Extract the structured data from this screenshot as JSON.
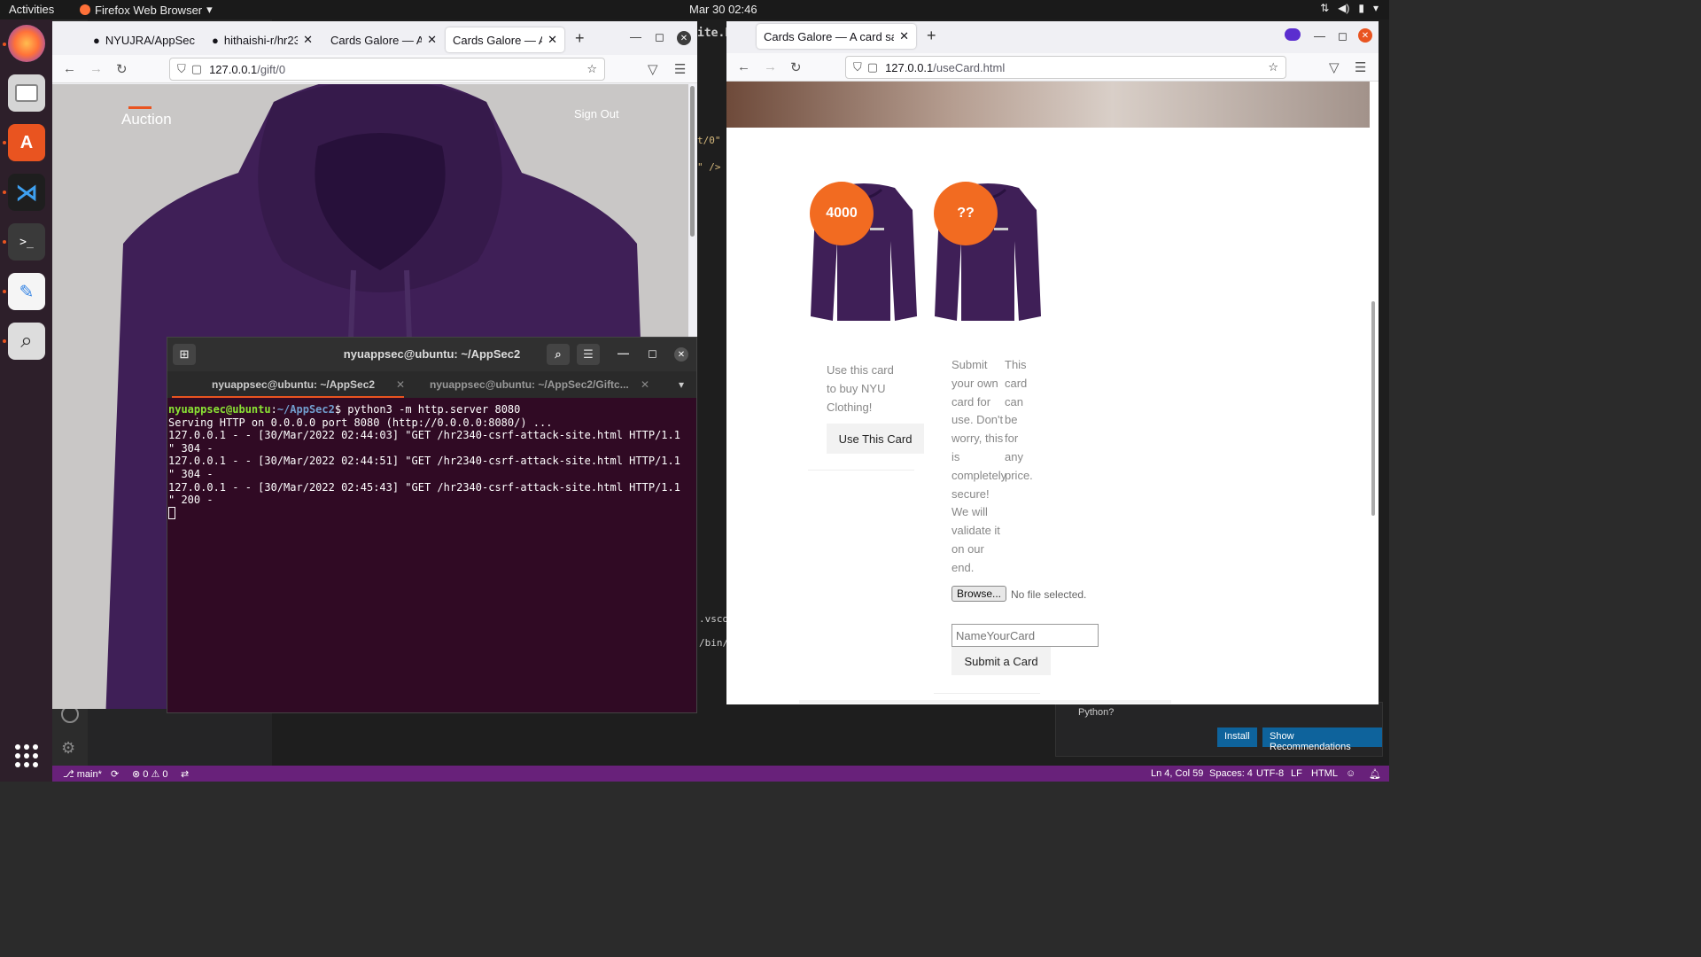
{
  "topbar": {
    "activities": "Activities",
    "app_name": "Firefox Web Browser",
    "clock": "Mar 30  02:46"
  },
  "left_firefox": {
    "tabs": [
      {
        "label": "NYUJRA/AppSec"
      },
      {
        "label": "hithaishi-r/hr234"
      },
      {
        "label": "Cards Galore — A ca"
      },
      {
        "label": "Cards Galore — A ca"
      }
    ],
    "url_host": "127.0.0.1",
    "url_path": "/gift/0",
    "page": {
      "brand": "Auction",
      "signout": "Sign Out"
    }
  },
  "terminal": {
    "title": "nyuappsec@ubuntu: ~/AppSec2",
    "tabs": [
      {
        "label": "nyuappsec@ubuntu: ~/AppSec2"
      },
      {
        "label": "nyuappsec@ubuntu: ~/AppSec2/Giftc..."
      }
    ],
    "prompt_user": "nyuappsec@ubuntu",
    "prompt_path": "~/AppSec2",
    "command": "$ python3 -m http.server 8080",
    "lines": [
      "Serving HTTP on 0.0.0.0 port 8080 (http://0.0.0.0:8080/) ...",
      "127.0.0.1 - - [30/Mar/2022 02:44:03] \"GET /hr2340-csrf-attack-site.html HTTP/1.1",
      "\" 304 -",
      "127.0.0.1 - - [30/Mar/2022 02:44:51] \"GET /hr2340-csrf-attack-site.html HTTP/1.1",
      "\" 304 -",
      "127.0.0.1 - - [30/Mar/2022 02:45:43] \"GET /hr2340-csrf-attack-site.html HTTP/1.1",
      "\" 200 -"
    ]
  },
  "right_firefox": {
    "tab_label": "Cards Galore — A card sale s",
    "url_host": "127.0.0.1",
    "url_path": "/useCard.html",
    "cards": [
      {
        "badge": "4000",
        "desc_lines": [
          "Use this card",
          "to buy NYU",
          "Clothing!"
        ],
        "button": "Use This Card"
      },
      {
        "badge": "??",
        "desc_col1": [
          "Submit",
          "your own",
          "card for",
          "use. Don't",
          "worry, this",
          "is",
          "completely",
          "secure!",
          "We will",
          "validate it",
          "on our",
          "end."
        ],
        "desc_col2": [
          "This",
          "card",
          "can",
          "be",
          "for",
          "any",
          "price."
        ],
        "browse": "Browse...",
        "nofile": "No file selected.",
        "name_placeholder": "NameYourCard",
        "submit": "Submit a Card"
      }
    ]
  },
  "vscode": {
    "peek_lines": [
      "ite.ht",
      "t/0\"",
      "\" />",
      ".vsco",
      "/bin/"
    ],
    "notification_question": "Python?",
    "install": "Install",
    "show_recommendations": "Show Recommendations",
    "status": {
      "branch": "main*",
      "errors": "⊗ 0 ⚠ 0",
      "position": "Ln 4, Col 59",
      "spaces": "Spaces: 4",
      "encoding": "UTF-8",
      "eol": "LF",
      "language": "HTML"
    }
  },
  "colors": {
    "accent_orange": "#f26b21",
    "terminal_bg": "#300a24",
    "vscode_status": "#68217a"
  }
}
